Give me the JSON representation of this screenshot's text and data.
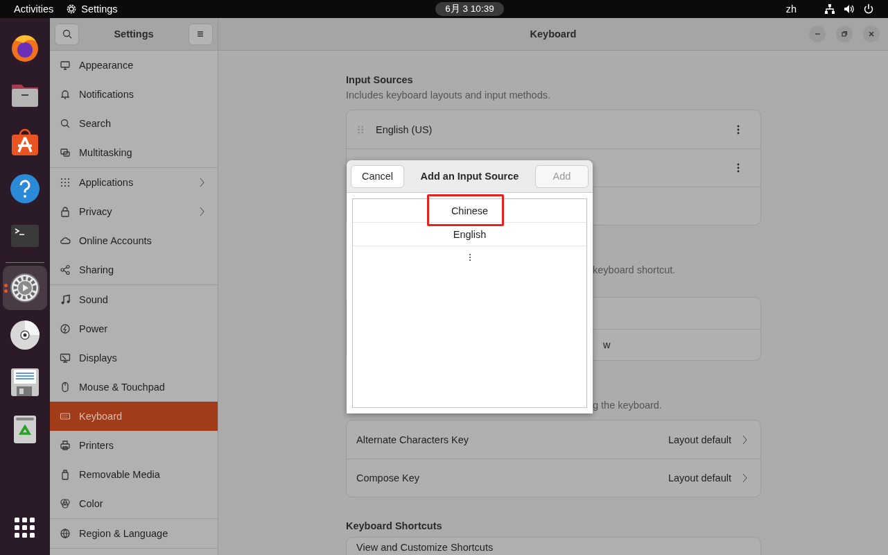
{
  "top_bar": {
    "activities": "Activities",
    "app_name": "Settings",
    "clock": "6月 3  10:39",
    "input_method": "zh"
  },
  "dock": {
    "items": [
      {
        "selected": false
      },
      {
        "selected": false
      },
      {
        "selected": false
      },
      {
        "selected": false
      },
      {
        "selected": false
      },
      {
        "selected": true
      },
      {
        "selected": false
      },
      {
        "selected": false
      },
      {
        "selected": false
      }
    ]
  },
  "sidebar": {
    "title": "Settings",
    "groups": [
      [
        {
          "label": "Appearance",
          "submenu": false,
          "selected": false
        },
        {
          "label": "Notifications",
          "submenu": false,
          "selected": false
        },
        {
          "label": "Search",
          "submenu": false,
          "selected": false
        },
        {
          "label": "Multitasking",
          "submenu": false,
          "selected": false
        }
      ],
      [
        {
          "label": "Applications",
          "submenu": true,
          "selected": false
        },
        {
          "label": "Privacy",
          "submenu": true,
          "selected": false
        },
        {
          "label": "Online Accounts",
          "submenu": false,
          "selected": false
        },
        {
          "label": "Sharing",
          "submenu": false,
          "selected": false
        }
      ],
      [
        {
          "label": "Sound",
          "submenu": false,
          "selected": false
        },
        {
          "label": "Power",
          "submenu": false,
          "selected": false
        },
        {
          "label": "Displays",
          "submenu": false,
          "selected": false
        },
        {
          "label": "Mouse & Touchpad",
          "submenu": false,
          "selected": false
        },
        {
          "label": "Keyboard",
          "submenu": false,
          "selected": true
        },
        {
          "label": "Printers",
          "submenu": false,
          "selected": false
        },
        {
          "label": "Removable Media",
          "submenu": false,
          "selected": false
        },
        {
          "label": "Color",
          "submenu": false,
          "selected": false
        }
      ],
      [
        {
          "label": "Region & Language",
          "submenu": false,
          "selected": false
        }
      ]
    ]
  },
  "main": {
    "title": "Keyboard",
    "input_sources": {
      "title": "Input Sources",
      "description": "Includes keyboard layouts and input methods.",
      "rows": [
        "English (US)"
      ]
    },
    "switching": {
      "description": "keyboard shortcut.",
      "row_text": "w"
    },
    "special": {
      "description": "g the keyboard.",
      "rows": [
        {
          "label": "Alternate Characters Key",
          "value": "Layout default"
        },
        {
          "label": "Compose Key",
          "value": "Layout default"
        }
      ]
    },
    "shortcuts": {
      "title": "Keyboard Shortcuts",
      "rows": [
        "View and Customize Shortcuts"
      ]
    }
  },
  "dialog": {
    "title": "Add an Input Source",
    "cancel": "Cancel",
    "add": {
      "label": "Add",
      "disabled": true
    },
    "items": [
      {
        "label": "Chinese",
        "annotated": true
      },
      {
        "label": "English",
        "annotated": false
      }
    ]
  }
}
